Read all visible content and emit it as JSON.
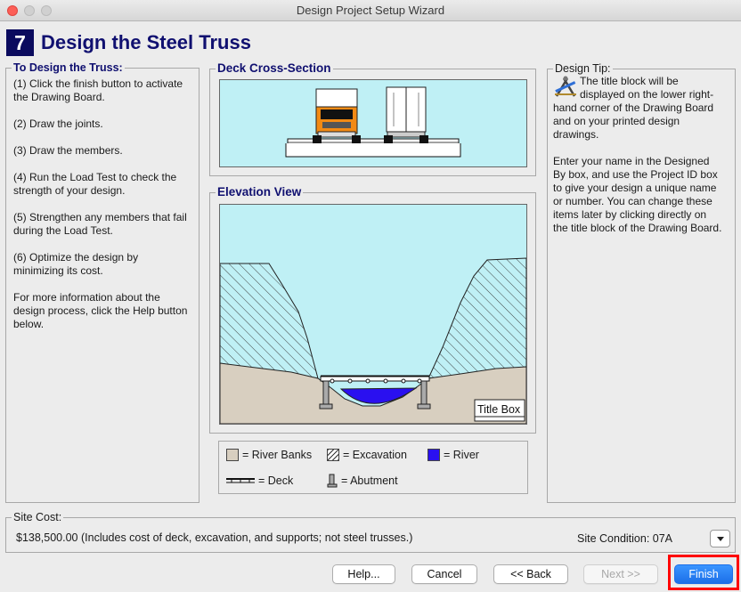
{
  "window": {
    "title": "Design Project Setup Wizard"
  },
  "header": {
    "step_number": "7",
    "title": "Design the Steel Truss"
  },
  "instructions": {
    "heading": "To Design the Truss:",
    "steps": [
      "(1) Click the finish button to activate the Drawing Board.",
      "(2) Draw the joints.",
      "(3) Draw the members.",
      "(4) Run the Load Test to check the strength of your design.",
      "(5) Strengthen any members that fail during the Load Test.",
      "(6) Optimize the design by minimizing its cost.",
      "For more information about the design process, click the Help button below."
    ]
  },
  "deck_section": {
    "heading": "Deck Cross-Section"
  },
  "elevation": {
    "heading": "Elevation View",
    "title_box_label": "Title Box"
  },
  "legend": {
    "river_banks": "= River Banks",
    "excavation": "= Excavation",
    "river": "= River",
    "deck": "= Deck",
    "abutment": "= Abutment"
  },
  "tip": {
    "heading": "Design Tip:",
    "paragraph1": "The title block will be displayed on the lower right-hand corner of the Drawing Board and on your printed design drawings.",
    "paragraph2": "Enter your name in the Designed By box, and use the Project ID box to give your design a unique name or number. You can change these items later by clicking directly on the title block of the Drawing Board."
  },
  "site_cost": {
    "heading": "Site Cost:",
    "text": "$138,500.00 (Includes cost of deck, excavation, and supports; not steel trusses.)",
    "condition": "Site Condition: 07A"
  },
  "buttons": {
    "help": "Help...",
    "cancel": "Cancel",
    "back": "<< Back",
    "next": "Next >>",
    "finish": "Finish"
  },
  "colors": {
    "title_blue": "#101070",
    "sky": "#bff0f5",
    "bank": "#d8cfc0",
    "river": "#2a10f0",
    "truck_orange": "#f28a14",
    "finish_highlight": "#ff0000"
  }
}
